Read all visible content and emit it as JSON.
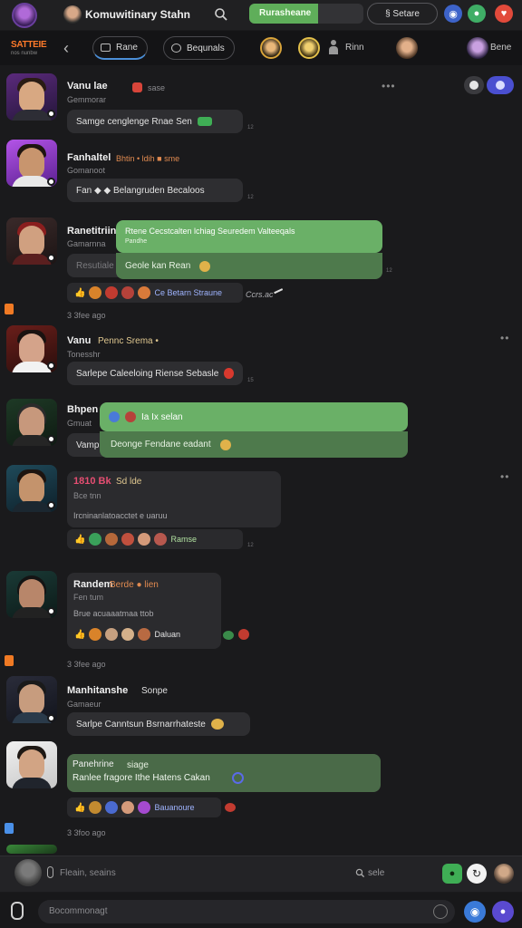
{
  "header": {
    "app_title": "Komuwitinary Stahn",
    "status_label": "Rurasheane",
    "status_progress": 0.6,
    "settings_label": "§ Setare",
    "brand": "SATTEIE",
    "brand_sub": "nos nunbw"
  },
  "subnav": {
    "back": "‹",
    "tab_1": "Rane",
    "tab_2": "Bequnals",
    "person_label": "Rinn",
    "right_label": "Bene"
  },
  "colors": {
    "accent_green": "#6ab067",
    "accent_blue": "#4b8fd8",
    "danger": "#e24a3b",
    "brand": "#ff7a2a"
  },
  "messages": [
    {
      "name": "Vanu lae",
      "name_extra": "sase",
      "sub": "Gemmorar",
      "bubble": "Samge cenglenge Rnae Sen",
      "time": "12"
    },
    {
      "name": "Fanhaltel",
      "name_extra": "Bhtin • ldih  ■ sme",
      "sub": "Gomanoot",
      "bubble": "Fan ◆ ◆ Belangruden Becaloos",
      "time": "12"
    },
    {
      "name": "Ranetitriin",
      "sub": "Gamarnna",
      "bubble_top": "Rtene Cecstcalten lchiag Seuredem Valteeqals",
      "bubble_top_sub": "Pandhe",
      "bubble": "Geole kan Rean",
      "ghost": "Resutiale clen",
      "reaction_text": "Ce Betarn Straune",
      "trail": "Ccrs.ac",
      "time": "12",
      "ago": "3 3fee ago"
    },
    {
      "name": "Vanu",
      "name_extra": "Pennc Srema •",
      "sub": "Tonesshr",
      "bubble": "Sarlepe Caleeloing Riense Sebasle",
      "time": "15"
    },
    {
      "name": "Bhpen",
      "sub": "Gmuat",
      "bubble_top": "Ia Ix selan",
      "bubble": "Vamp",
      "bubble_green": "Deonge Fendane eadant"
    },
    {
      "name": "1810 Bk",
      "name_extra": "Sd lde",
      "sub": "Bce tnn",
      "detail": "Ircninanlatoacctet e uaruu",
      "reaction_text": "Ramse",
      "time": "12"
    },
    {
      "name": "Randem",
      "name_extra": "Berde ● lien",
      "sub": "Fen tum",
      "detail": "Brue acuaaatmaa ttob",
      "reaction_text": "Daluan",
      "ago": "3 3fee ago"
    },
    {
      "name": "Manhitanshe",
      "name_extra": "Sonpe",
      "sub": "Gamaeur",
      "bubble": "Sarlpe Canntsun Bsrnarrhateste"
    },
    {
      "name": "Panehrine",
      "name_extra": "siage",
      "sub": "Ranlee fragore Ithe Hatens Cakan",
      "reaction_text": "Bauanoure",
      "ago": "3 3foo ago"
    }
  ],
  "composer": {
    "placeholder": "Fleain, seains",
    "search": "sele",
    "bottom_placeholder": "Bocommonagt"
  }
}
